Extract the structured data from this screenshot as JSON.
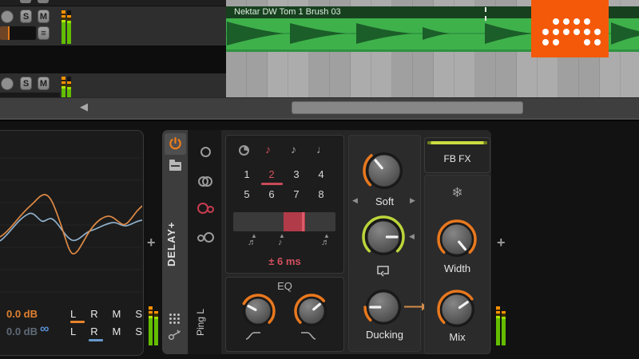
{
  "arranger": {
    "clip_name": "Nektar DW Tom 1 Brush 03",
    "track1": {
      "solo": "S",
      "mute": "M",
      "menu_icon": "≡"
    },
    "track2": {
      "solo": "S",
      "mute": "M"
    },
    "scroll_left_arrow": "◀"
  },
  "inspector": {
    "gain_a": "0.0 dB",
    "gain_b": "0.0 dB",
    "channels_a": [
      "L",
      "R",
      "M",
      "S"
    ],
    "channels_b": [
      "L",
      "R",
      "M",
      "S"
    ],
    "link_icon": "∞",
    "add_button": "+"
  },
  "delay_device": {
    "name": "DELAY+",
    "mode_label": "Ping L",
    "time": {
      "note_straight": "♪",
      "note_dotted": "♪",
      "note_quarter": "♩",
      "numbers": [
        "1",
        "2",
        "3",
        "4",
        "5",
        "6",
        "7",
        "8"
      ],
      "selected_number": "2",
      "marker": "▲",
      "marker_note_left": "♬",
      "marker_note_mid": "♪",
      "marker_note_right": "♬",
      "offset_value": "± 6 ms"
    },
    "eq_label": "EQ",
    "soft_label": "Soft",
    "ducking_label": "Ducking",
    "browse_left": "◀",
    "browse_right": "▶",
    "mod_arrow": "◀",
    "fb_fx_label": "FB FX",
    "freeze_icon": "❄",
    "width_label": "Width",
    "mix_label": "Mix",
    "add_button": "+"
  },
  "knobs": {
    "soft": {
      "ptr": -40,
      "arc": [
        -135,
        -40
      ],
      "color": "#e8781e",
      "body": 20,
      "arcR": 25
    },
    "feedback": {
      "ptr": 90,
      "arc": [
        -135,
        135
      ],
      "color": "#bcd53a",
      "body": 20,
      "arcR": 25
    },
    "ducking": {
      "ptr": -90,
      "arc": [
        -135,
        -90
      ],
      "color": "#e8781e",
      "body": 19,
      "arcR": 23
    },
    "eq_hp": {
      "ptr": -62,
      "arc": [
        -62,
        135
      ],
      "color": "#e8781e",
      "body": 16,
      "arcR": 20
    },
    "eq_lp": {
      "ptr": 50,
      "arc": [
        -135,
        50
      ],
      "color": "#e8781e",
      "body": 16,
      "arcR": 20
    },
    "width": {
      "ptr": 140,
      "arc": [
        -135,
        135
      ],
      "color": "#e8781e",
      "body": 19,
      "arcR": 23
    },
    "mix": {
      "ptr": 55,
      "arc": [
        -135,
        55
      ],
      "color": "#e8781e",
      "body": 19,
      "arcR": 23
    }
  },
  "colors": {
    "accent_orange": "#e8781e",
    "lime": "#c9dd3f",
    "red": "#d4505f",
    "clip_green": "#3fb14b",
    "logo_orange": "#f4590a",
    "link_blue": "#5b8fd4"
  }
}
